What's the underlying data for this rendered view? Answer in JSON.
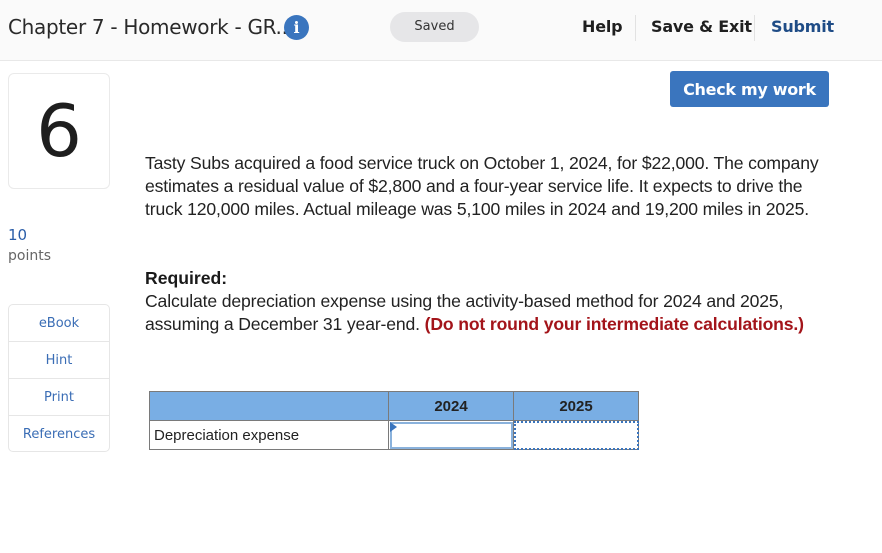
{
  "header": {
    "title": "Chapter 7 - Homework - GR...",
    "info_icon": "info-icon",
    "status": "Saved",
    "nav": {
      "help": "Help",
      "save_exit": "Save & Exit",
      "submit": "Submit"
    }
  },
  "toolbar": {
    "check_label": "Check my work"
  },
  "question": {
    "number": "6",
    "points_value": "10",
    "points_label": "points"
  },
  "resources": [
    {
      "label": "eBook"
    },
    {
      "label": "Hint"
    },
    {
      "label": "Print"
    },
    {
      "label": "References"
    }
  ],
  "problem": {
    "text": "Tasty Subs acquired a food service truck on October 1, 2024, for $22,000. The company estimates a residual value of $2,800 and a four-year service life. It expects to drive the truck 120,000 miles. Actual mileage was 5,100 miles in 2024 and 19,200 miles in 2025.",
    "required_heading": "Required:",
    "required_text": "Calculate depreciation expense using the activity-based method for 2024 and 2025, assuming a December 31 year-end.",
    "required_note": "(Do not round your intermediate calculations.)"
  },
  "answer_table": {
    "headers": [
      "",
      "2024",
      "2025"
    ],
    "rows": [
      {
        "label": "Depreciation expense",
        "values": [
          "",
          ""
        ]
      }
    ]
  },
  "colors": {
    "accent": "#3a75be",
    "submit": "#1f4c86",
    "emphasis": "#a3141a",
    "table_header": "#79aee4"
  }
}
